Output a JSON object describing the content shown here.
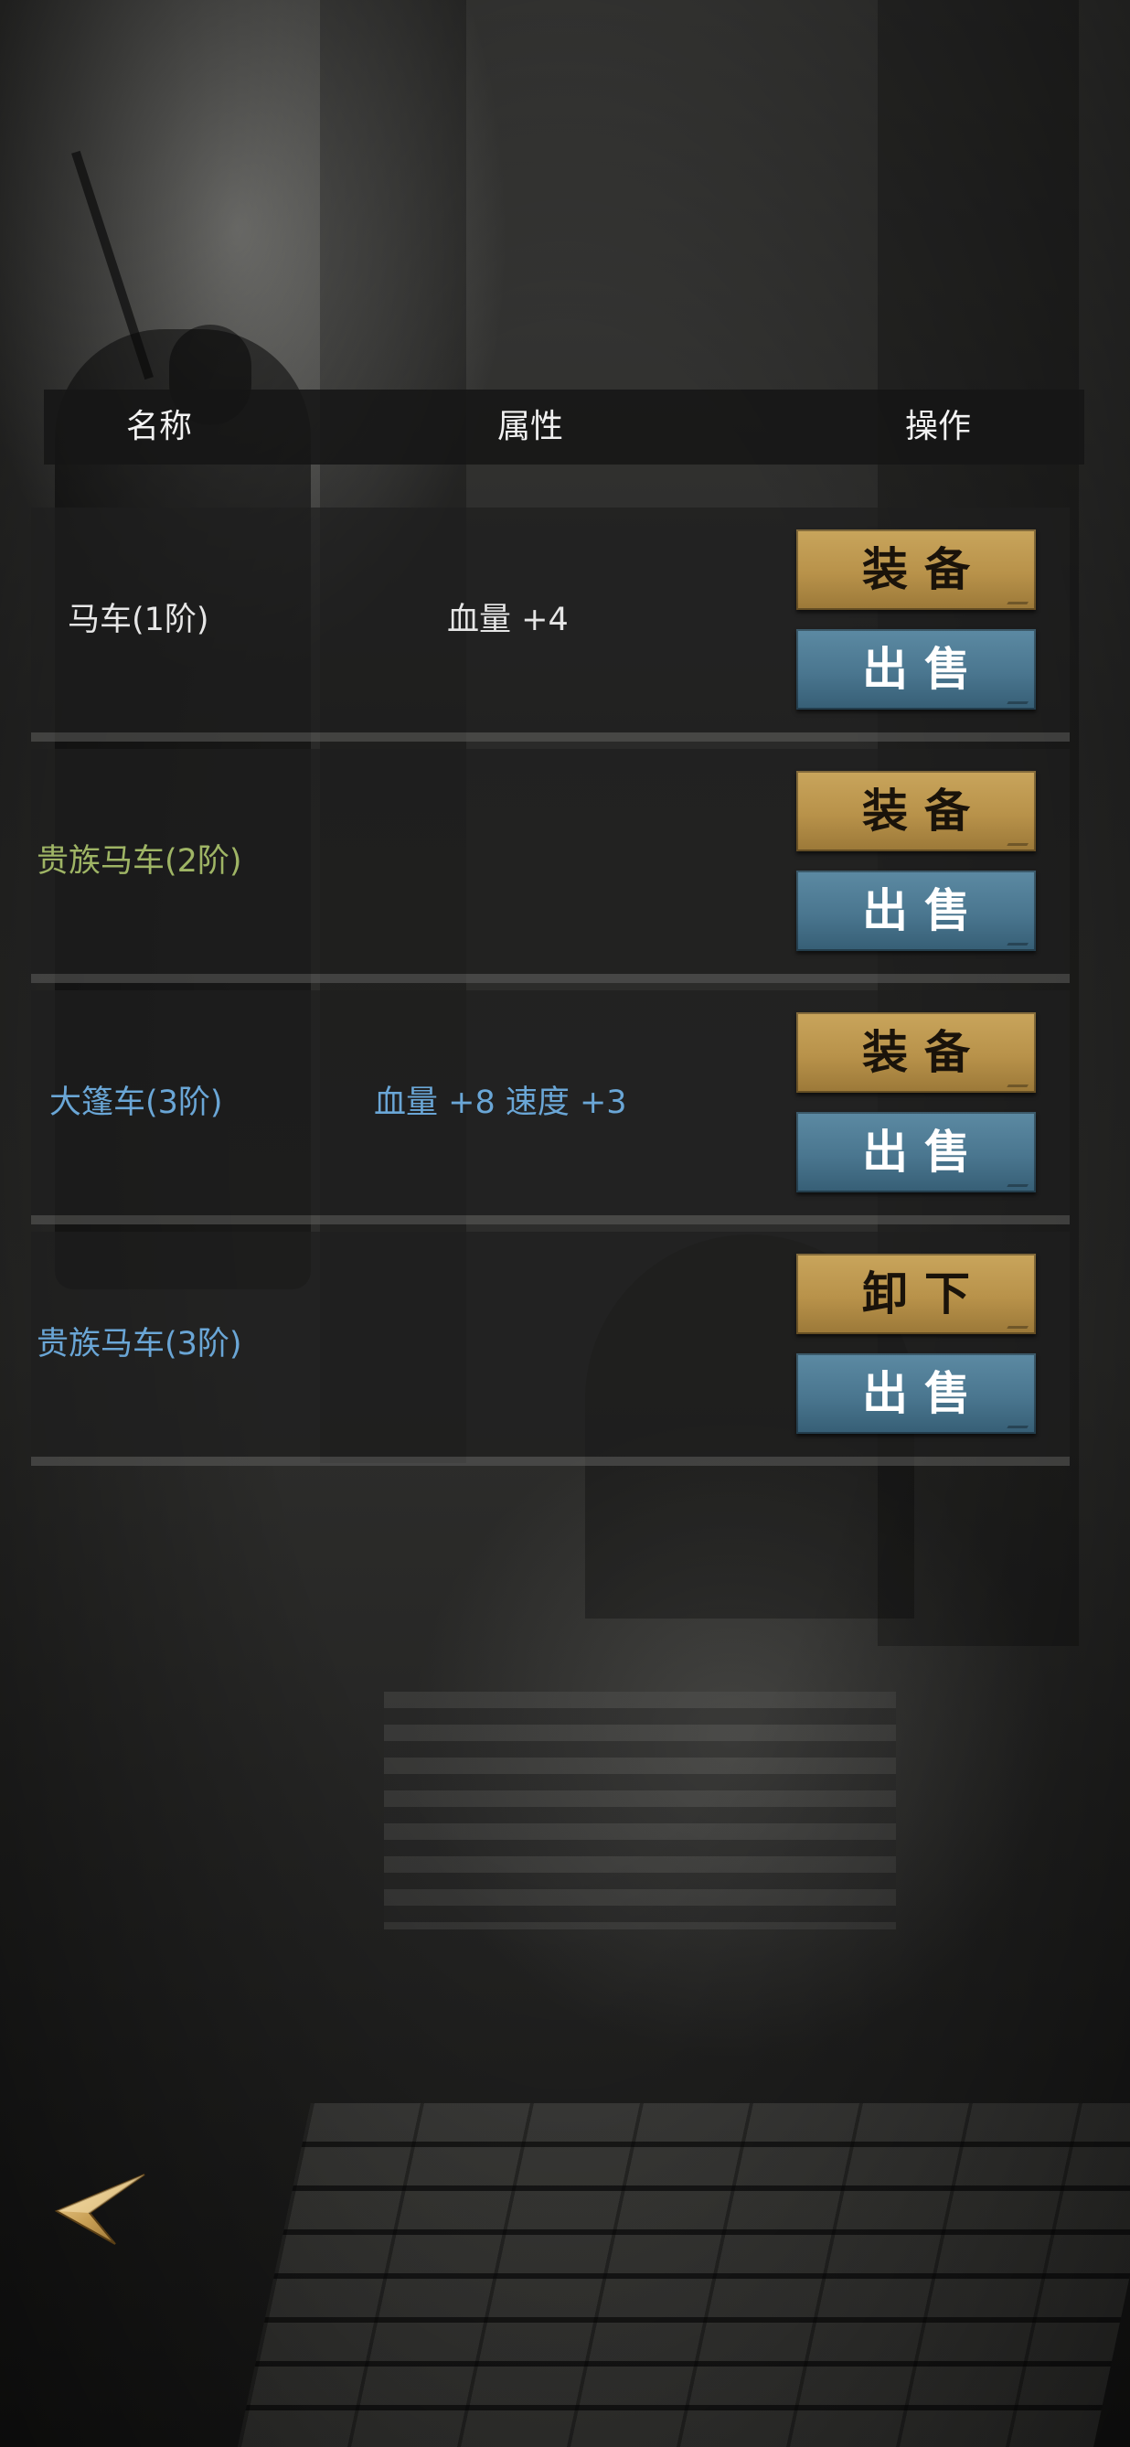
{
  "header": {
    "name": "名称",
    "attr": "属性",
    "op": "操作"
  },
  "rows": [
    {
      "name": "马车(1阶)",
      "name_color": "#e6e6e6",
      "attr": "血量 +4",
      "attr_color": "#e6e6e6",
      "btn1": "装备",
      "btn2": "出售"
    },
    {
      "name": "贵族马车(2阶)",
      "name_color": "#9fb565",
      "attr": "",
      "attr_color": "#9fb565",
      "btn1": "装备",
      "btn2": "出售"
    },
    {
      "name": "大篷车(3阶)",
      "name_color": "#6aa6d6",
      "attr": "血量 +8  速度 +3",
      "attr_color": "#6aa6d6",
      "btn1": "装备",
      "btn2": "出售"
    },
    {
      "name": "贵族马车(3阶)",
      "name_color": "#6aa6d6",
      "attr": "",
      "attr_color": "#6aa6d6",
      "btn1": "卸下",
      "btn2": "出售"
    }
  ],
  "colors": {
    "gold_button": "#c9a55c",
    "blue_button": "#4a768f",
    "tier1": "#e6e6e6",
    "tier2": "#9fb565",
    "tier3": "#6aa6d6"
  },
  "icons": {
    "back": "back-arrow-icon"
  }
}
